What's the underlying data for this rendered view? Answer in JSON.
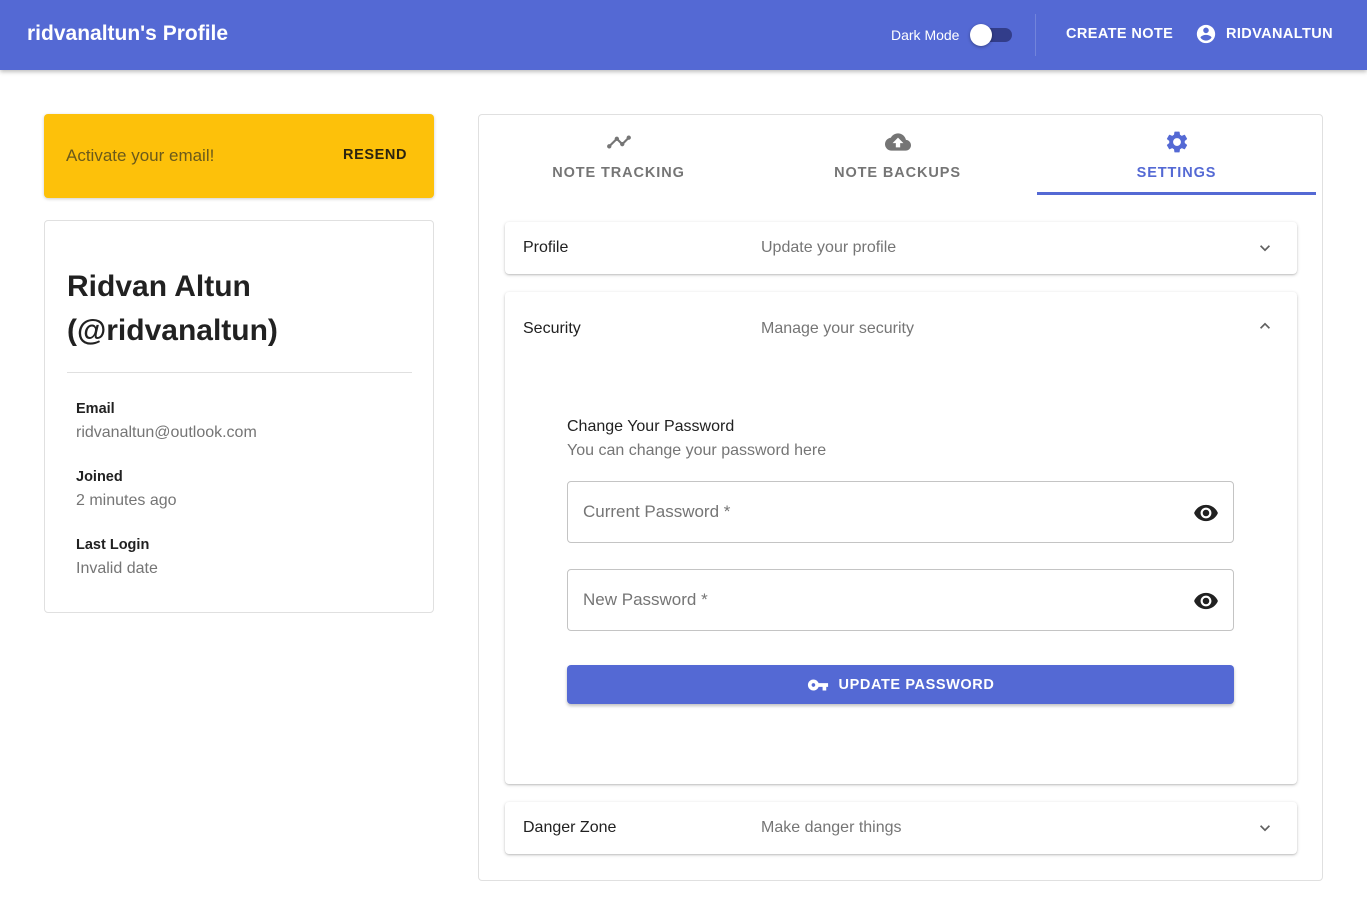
{
  "appbar": {
    "title": "ridvanaltun's Profile",
    "dark_mode_label": "Dark Mode",
    "create_note": "CREATE NOTE",
    "user": "RIDVANALTUN"
  },
  "alert": {
    "message": "Activate your email!",
    "action": "RESEND"
  },
  "profile": {
    "name_line1": "Ridvan Altun",
    "name_line2": "(@ridvanaltun)",
    "email_label": "Email",
    "email_value": "ridvanaltun@outlook.com",
    "joined_label": "Joined",
    "joined_value": "2 minutes ago",
    "last_login_label": "Last Login",
    "last_login_value": "Invalid date"
  },
  "tabs": [
    {
      "label": "NOTE TRACKING",
      "icon": "trending-icon"
    },
    {
      "label": "NOTE BACKUPS",
      "icon": "cloud-upload-icon"
    },
    {
      "label": "SETTINGS",
      "icon": "gear-icon",
      "active": true
    }
  ],
  "panels": {
    "profile": {
      "title": "Profile",
      "subtitle": "Update your profile",
      "expanded": false
    },
    "security": {
      "title": "Security",
      "subtitle": "Manage your security",
      "expanded": true,
      "heading": "Change Your Password",
      "subheading": "You can change your password here",
      "current_password_placeholder": "Current Password *",
      "new_password_placeholder": "New Password *",
      "update_button": "UPDATE PASSWORD"
    },
    "danger": {
      "title": "Danger Zone",
      "subtitle": "Make danger things",
      "expanded": false
    }
  },
  "colors": {
    "primary": "#5469d4",
    "warning": "#fdc10a",
    "text_primary": "#212121",
    "text_secondary": "#757575"
  }
}
